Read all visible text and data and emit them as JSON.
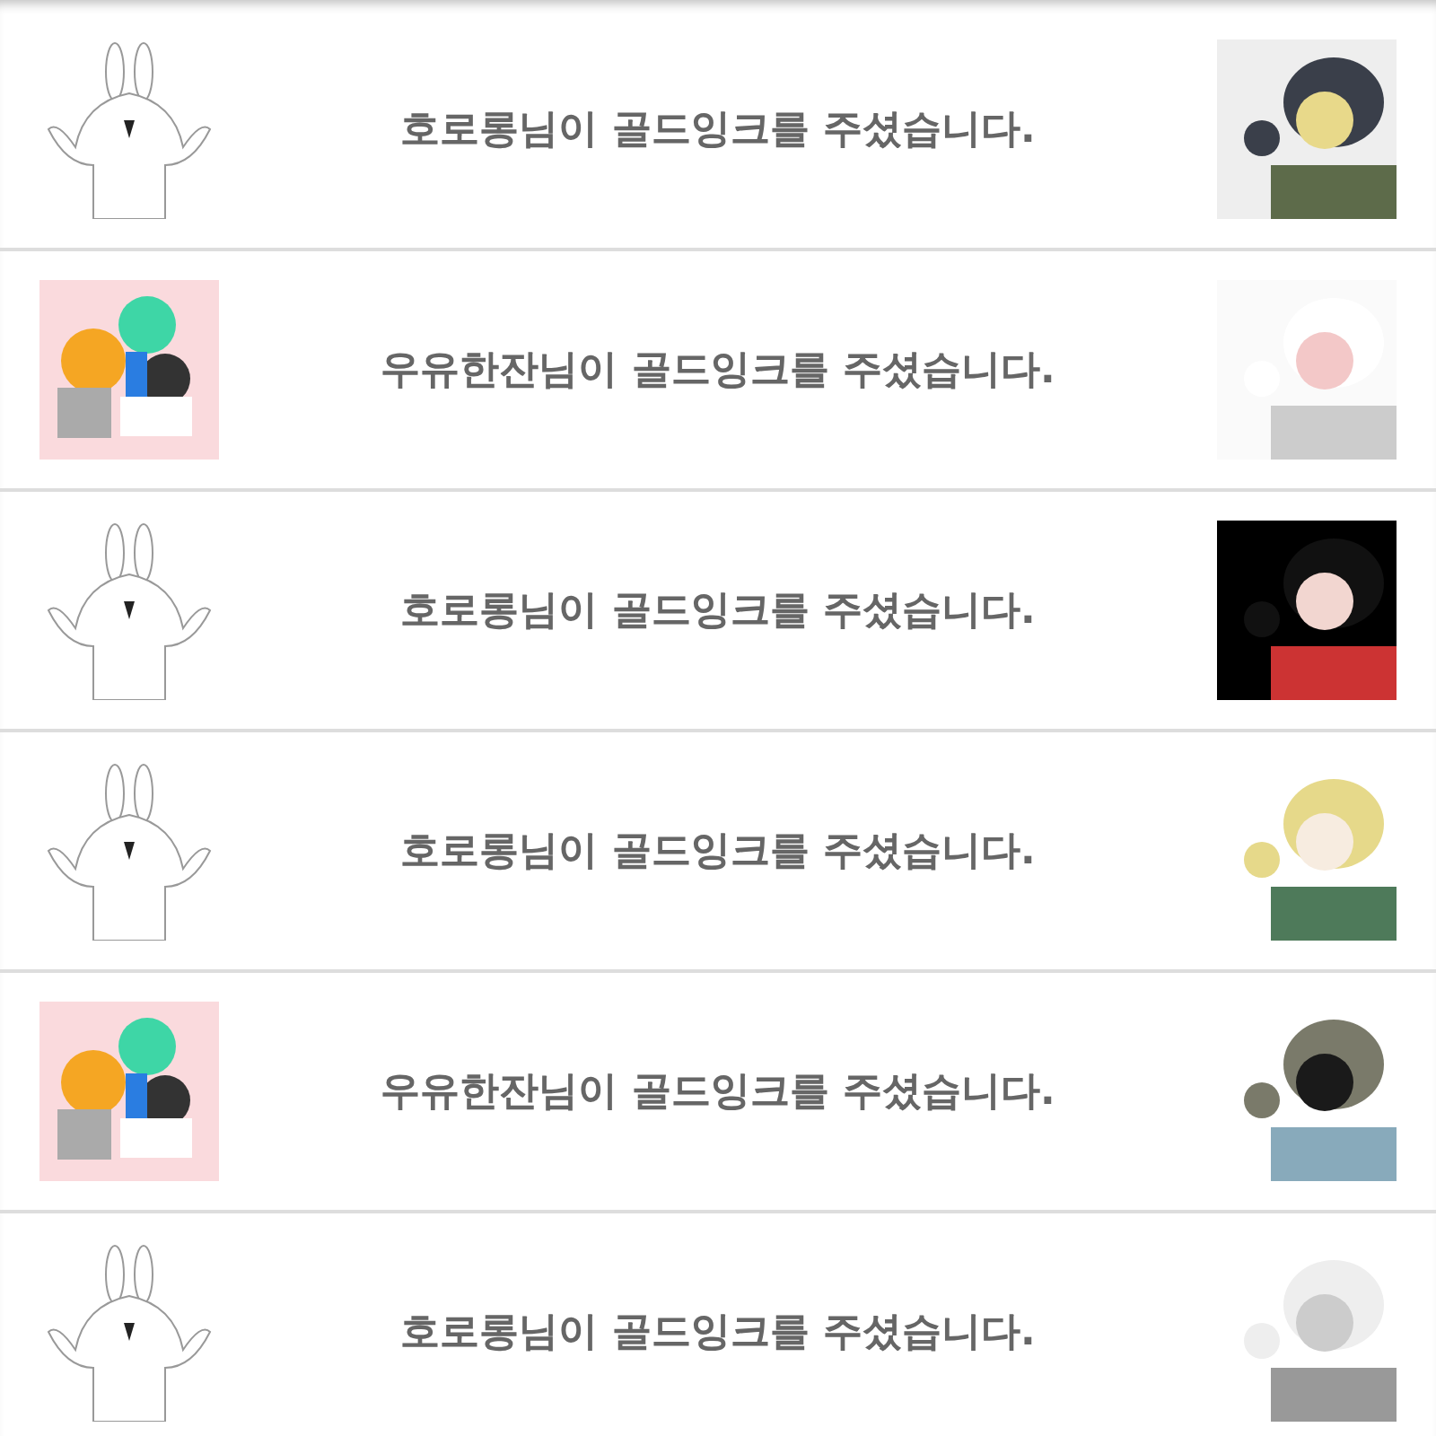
{
  "notifications": [
    {
      "message": "호로롱님이 골드잉크를 주셨습니다."
    },
    {
      "message": "우유한잔님이 골드잉크를 주셨습니다."
    },
    {
      "message": "호로롱님이 골드잉크를 주셨습니다."
    },
    {
      "message": "호로롱님이 골드잉크를 주셨습니다."
    },
    {
      "message": "우유한잔님이 골드잉크를 주셨습니다."
    },
    {
      "message": "호로롱님이 골드잉크를 주셨습니다."
    }
  ]
}
